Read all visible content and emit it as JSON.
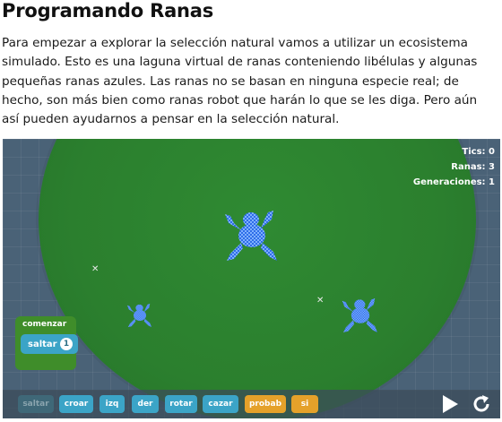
{
  "page": {
    "title": "Programando Ranas",
    "intro": "Para empezar a explorar la selección natural vamos a utilizar un ecosistema simulado. Esto es una laguna virtual de ranas conteniendo libélulas y algunas pequeñas ranas azules. Las ranas no se basan en ninguna especie real; de hecho, son más bien como ranas robot que harán lo que se les diga. Pero aún así pueden ayudarnos a pensar en la selección natural."
  },
  "stats": {
    "ticks": "Tics: 0",
    "frogs": "Ranas: 3",
    "generations": "Generaciones: 1"
  },
  "program": {
    "start_label": "comenzar",
    "block_label": "saltar",
    "block_value": "1"
  },
  "toolbar": {
    "blocks": [
      "saltar",
      "croar",
      "izq",
      "der",
      "rotar",
      "cazar",
      "probab",
      "si"
    ],
    "play_icon": "play-icon",
    "reset_icon": "reset-icon"
  },
  "colors": {
    "pond": "#2b7f2e",
    "water": "#4a6277",
    "frog": "#2f6ee8",
    "block_blue": "#3ba4c7",
    "block_orange": "#e5a12a",
    "program_green": "#3f8d2a"
  }
}
